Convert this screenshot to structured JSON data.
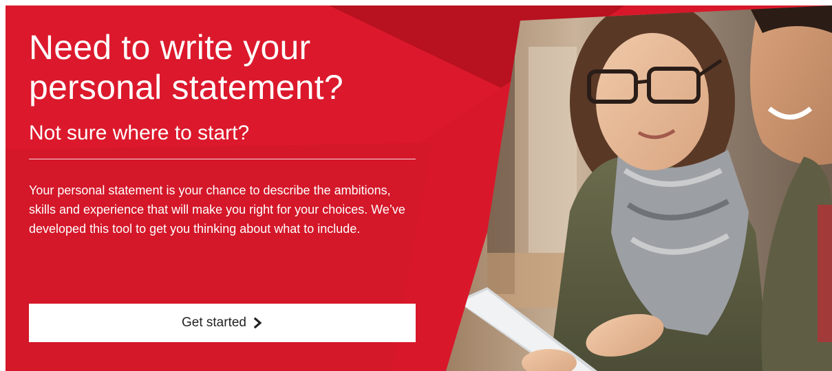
{
  "banner": {
    "headline": "Need to write your personal statement?",
    "subheading": "Not sure where to start?",
    "description": "Your personal statement is your chance to describe the ambitions, skills and experience that will make you right for your choices. We’ve developed this tool to get you thinking about what to include.",
    "cta": {
      "label": "Get started",
      "icon": "chevron-right-icon"
    },
    "photo": "two-students-looking-at-tablet"
  },
  "colors": {
    "brand_red": "#d8182a",
    "dark_red": "#b5121f",
    "text_on_red": "#ffffff",
    "button_bg": "#ffffff",
    "button_text": "#222222"
  }
}
